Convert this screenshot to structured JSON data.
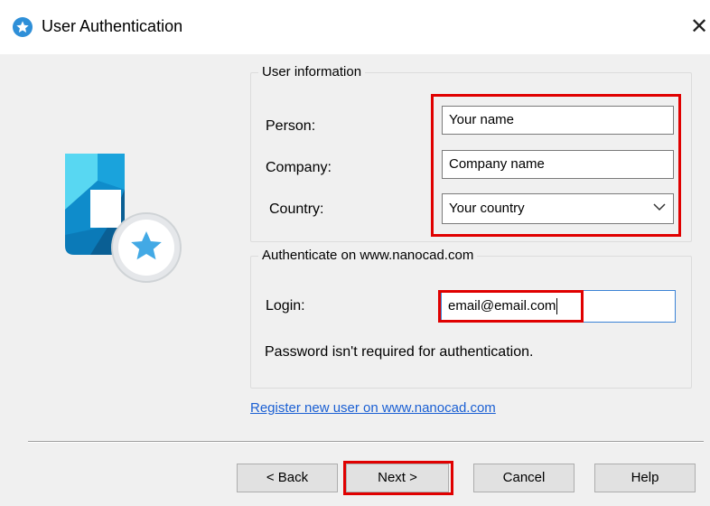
{
  "window": {
    "title": "User Authentication",
    "close_glyph": "✕"
  },
  "logo": {
    "icon": "nanocad-logo-icon"
  },
  "user_info": {
    "group_title": "User information",
    "person_label": "Person:",
    "person_value": "Your name",
    "company_label": "Company:",
    "company_value": "Company name",
    "country_label": "Country:",
    "country_value": "Your country"
  },
  "auth": {
    "group_title": "Authenticate on www.nanocad.com",
    "login_label": "Login:",
    "login_value": "email@email.com",
    "note": "Password isn't required for authentication."
  },
  "register_link": "Register new user on www.nanocad.com",
  "buttons": {
    "back": "< Back",
    "next": "Next >",
    "cancel": "Cancel",
    "help": "Help"
  },
  "colors": {
    "highlight": "#e00000",
    "link": "#1a5fd3",
    "accent": "#2e8fd8"
  }
}
